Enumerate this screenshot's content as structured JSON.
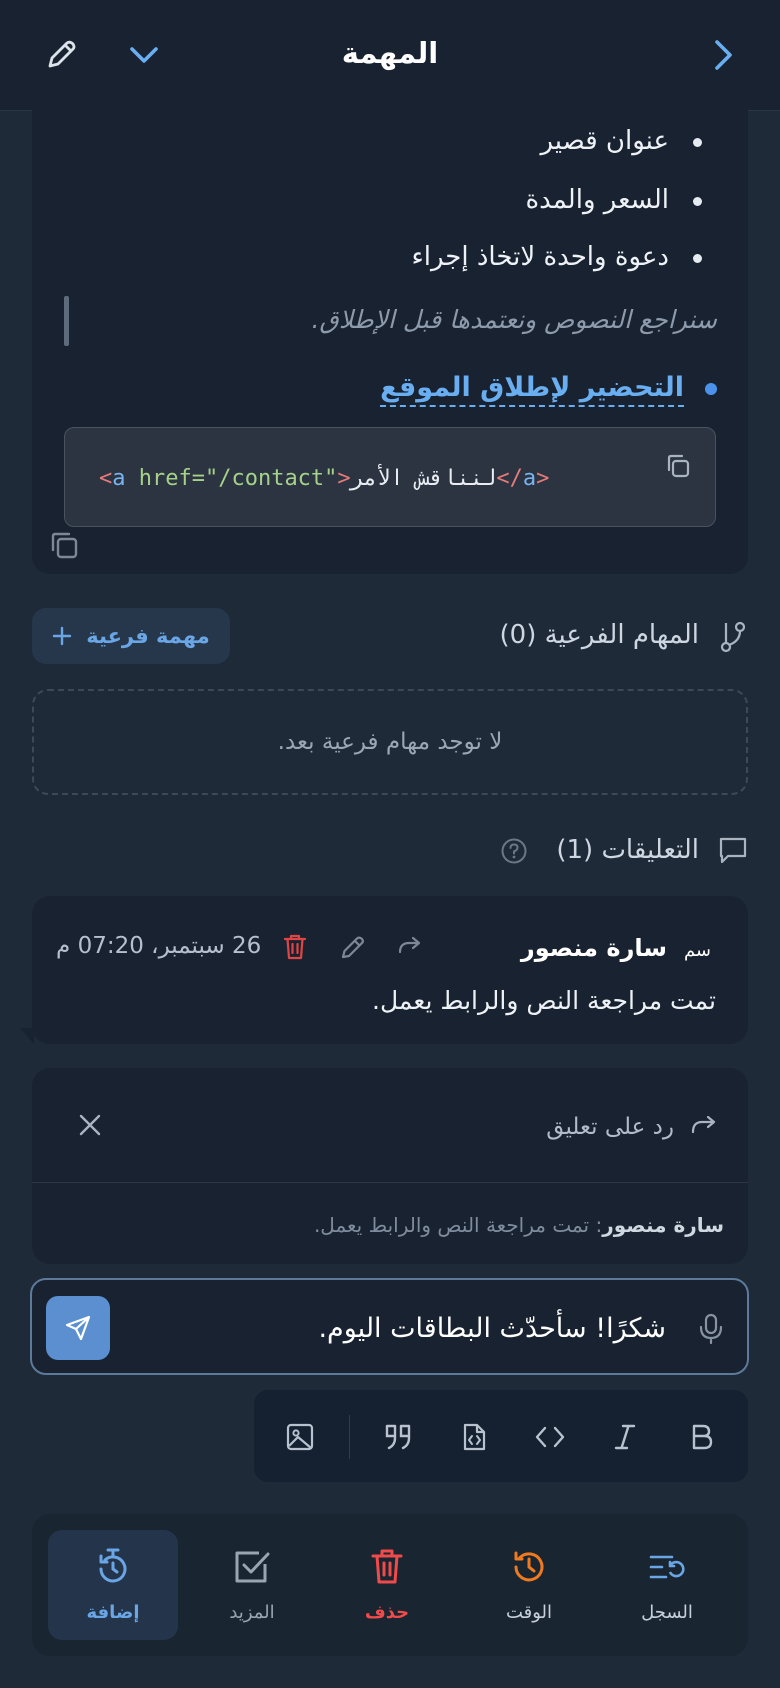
{
  "header": {
    "title": "المهمة"
  },
  "description": {
    "bullets": [
      "عنوان قصير",
      "السعر والمدة",
      "دعوة واحدة لاتخاذ إجراء"
    ],
    "quote": "سنراجع النصوص ونعتمدها قبل الإطلاق.",
    "link_item": "التحضير لإطلاق الموقع",
    "code": {
      "open_bracket": "<",
      "tag": "a",
      "attr": " href=\"/contact\"",
      "close_bracket": ">",
      "text": "لنناقش الأمر",
      "end_open": "</",
      "end_tag": "a",
      "end_close": ">"
    }
  },
  "subtasks": {
    "label": "المهام الفرعية (0)",
    "add_button": "مهمة فرعية",
    "empty": "لا توجد مهام فرعية بعد."
  },
  "comments": {
    "label": "التعليقات (1)",
    "items": [
      {
        "avatar": "سم",
        "author": "سارة منصور",
        "time": "26 سبتمبر، 07:20 م",
        "body": "تمت مراجعة النص والرابط يعمل."
      }
    ]
  },
  "reply": {
    "label": "رد على تعليق",
    "quote_author": "سارة منصور",
    "quote_text": ": تمت مراجعة النص والرابط يعمل."
  },
  "input": {
    "value": "شكرًا! سأحدّث البطاقات اليوم."
  },
  "actions": [
    {
      "label": "السجل",
      "color": "#6aa6e6"
    },
    {
      "label": "الوقت",
      "color": "#f07a1f"
    },
    {
      "label": "حذف",
      "color": "#ef4b4b"
    },
    {
      "label": "المزيد",
      "color": "#9aa5b2"
    },
    {
      "label": "إضافة",
      "color": "#6aa6e6"
    }
  ]
}
